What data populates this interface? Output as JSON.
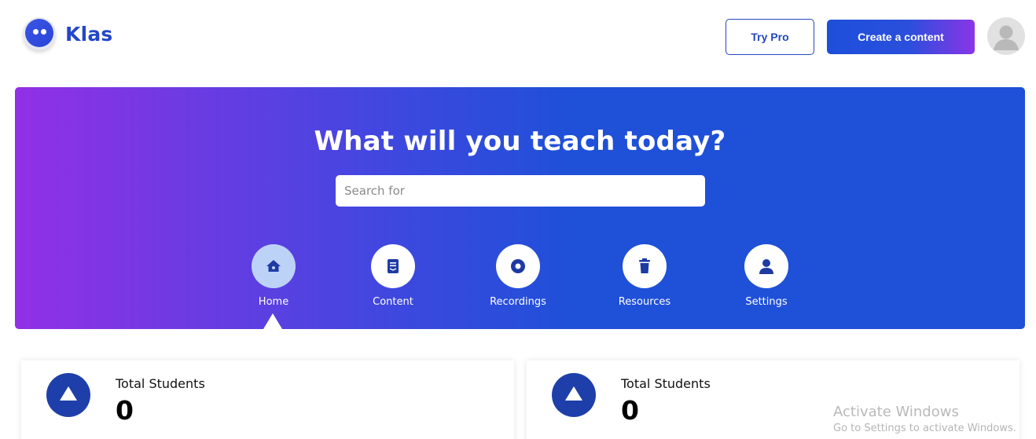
{
  "app": {
    "name": "Klas"
  },
  "header": {
    "try_pro_label": "Try Pro",
    "create_label": "Create a content"
  },
  "hero": {
    "title": "What will you teach today?",
    "search_placeholder": "Search for"
  },
  "nav": [
    {
      "label": "Home",
      "icon": "home-icon",
      "active": true
    },
    {
      "label": "Content",
      "icon": "document-icon",
      "active": false
    },
    {
      "label": "Recordings",
      "icon": "record-icon",
      "active": false
    },
    {
      "label": "Resources",
      "icon": "trash-icon",
      "active": false
    },
    {
      "label": "Settings",
      "icon": "user-icon",
      "active": false
    }
  ],
  "stats": [
    {
      "title": "Total Students",
      "value": "0"
    },
    {
      "title": "Total Students",
      "value": "0"
    }
  ],
  "watermark": {
    "line1": "Activate Windows",
    "line2": "Go to Settings to activate Windows."
  },
  "colors": {
    "brand": "#2447c9",
    "hero_start": "#9230e6",
    "hero_end": "#1f50d8",
    "stat_icon": "#1e3fa9"
  }
}
